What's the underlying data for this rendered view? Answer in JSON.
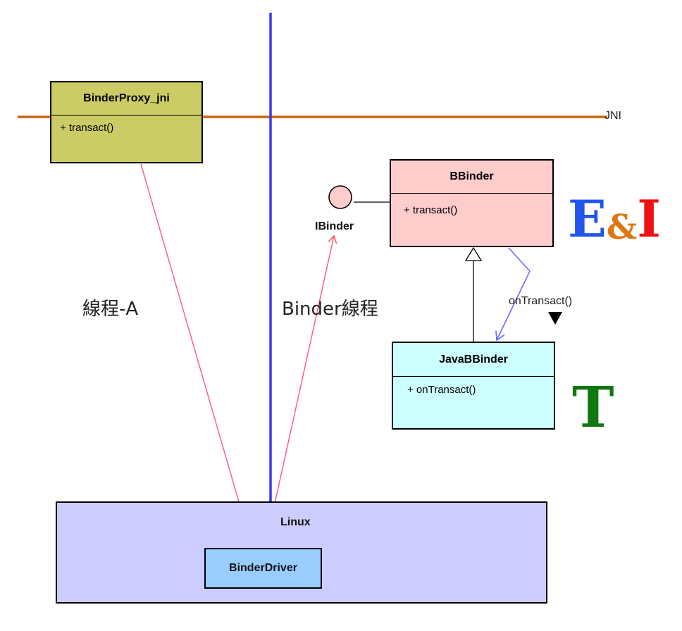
{
  "jni_label": "JNI",
  "binder_proxy": {
    "name": "BinderProxy_jni",
    "operation": "+ transact()"
  },
  "bbinder": {
    "name": "BBinder",
    "operation": "+ transact()"
  },
  "java_bbinder": {
    "name": "JavaBBinder",
    "operation": "+ onTransact()"
  },
  "ibinder_label": "IBinder",
  "on_transact_label": "onTransact()",
  "thread_a_label": "線程-A",
  "binder_thread_label": "Binder線程",
  "linux_label": "Linux",
  "binder_driver_label": "BinderDriver",
  "ei_letters": {
    "e": "E",
    "amp": "&",
    "i": "I"
  },
  "t_letter": "T",
  "colors": {
    "jni_line": "#c8640a",
    "vertical_line": "#3a3aee",
    "binder_proxy_fill": "#cccc66",
    "bbinder_fill": "#ffcccc",
    "java_bbinder_fill": "#ccffff",
    "linux_fill": "#ccccff",
    "binder_driver_fill": "#99ccff",
    "thread_arrow": "#ff5577",
    "on_transact_arrow": "#6666ff",
    "e_color": "#2255ee",
    "amp_color": "#dd7711",
    "i_color": "#ee1111",
    "t_color": "#117711"
  }
}
